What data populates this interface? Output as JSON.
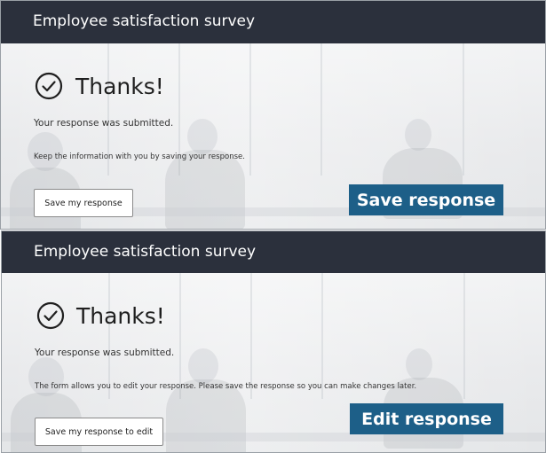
{
  "panels": [
    {
      "header_title": "Employee satisfaction survey",
      "thanks": "Thanks!",
      "message": "Your response was submitted.",
      "note": "Keep the information with you by saving your response.",
      "button_label": "Save my response",
      "callout": "Save response"
    },
    {
      "header_title": "Employee satisfaction survey",
      "thanks": "Thanks!",
      "message": "Your response was submitted.",
      "note": "The form allows you to edit your response. Please save the response so you can make changes later.",
      "button_label": "Save my response to edit",
      "callout": "Edit response"
    }
  ],
  "colors": {
    "header_bg": "#2b303c",
    "callout_bg": "#1d5f88"
  },
  "icons": {
    "success": "check-circle-icon"
  }
}
